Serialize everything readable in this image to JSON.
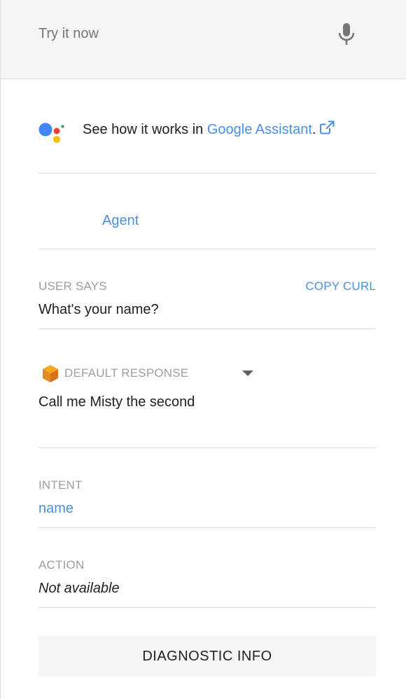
{
  "try_bar": {
    "placeholder": "Try it now",
    "mic_icon": "microphone-icon"
  },
  "google_assistant": {
    "logo_icon": "google-assistant-logo",
    "text": "See how it works in ",
    "link": "Google Assistant",
    "suffix": ".",
    "external_icon": "external-link-icon"
  },
  "agent_tab": {
    "label": "Agent"
  },
  "user_says": {
    "label": "USER SAYS",
    "copy_label": "COPY CURL",
    "value": "What's your name?"
  },
  "default_response": {
    "icon": "cube-icon",
    "label": "DEFAULT RESPONSE",
    "dropdown_icon": "triangle-down-icon",
    "value": "Call me Misty the second"
  },
  "intent": {
    "label": "INTENT",
    "value": "name"
  },
  "action": {
    "label": "ACTION",
    "value": "Not available"
  },
  "diagnostic": {
    "label": "DIAGNOSTIC INFO"
  },
  "colors": {
    "link": "#4a90e2",
    "label": "#9e9e9e",
    "text": "#212121",
    "bar_bg": "#f5f5f5",
    "divider": "#dcdcdc"
  }
}
